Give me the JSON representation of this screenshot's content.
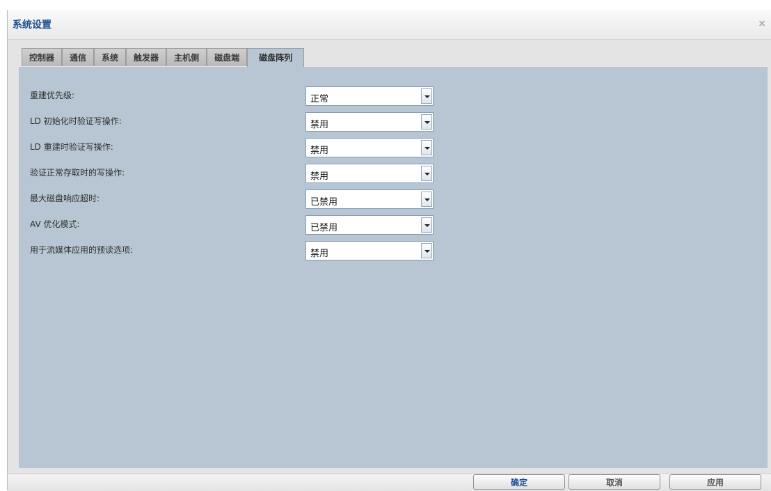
{
  "dialog": {
    "title": "系统设置",
    "close_icon": "×"
  },
  "tabs": [
    {
      "label": "控制器"
    },
    {
      "label": "通信"
    },
    {
      "label": "系统"
    },
    {
      "label": "触发器"
    },
    {
      "label": "主机侧"
    },
    {
      "label": "磁盘端"
    },
    {
      "label": "磁盘阵列",
      "active": true
    }
  ],
  "settings": [
    {
      "label": "重建优先级:",
      "value": "正常"
    },
    {
      "label": "LD 初始化时验证写操作:",
      "value": "禁用"
    },
    {
      "label": "LD 重建时验证写操作:",
      "value": "禁用"
    },
    {
      "label": "验证正常存取时的写操作:",
      "value": "禁用"
    },
    {
      "label": "最大磁盘响应超时:",
      "value": "已禁用"
    },
    {
      "label": "AV 优化模式:",
      "value": "已禁用"
    },
    {
      "label": "用于流媒体应用的预读选项:",
      "value": "禁用"
    }
  ],
  "buttons": {
    "ok": "确定",
    "cancel": "取消",
    "apply": "应用"
  },
  "colors": {
    "title": "#1d4f93",
    "panel": "#b7c6d2"
  }
}
